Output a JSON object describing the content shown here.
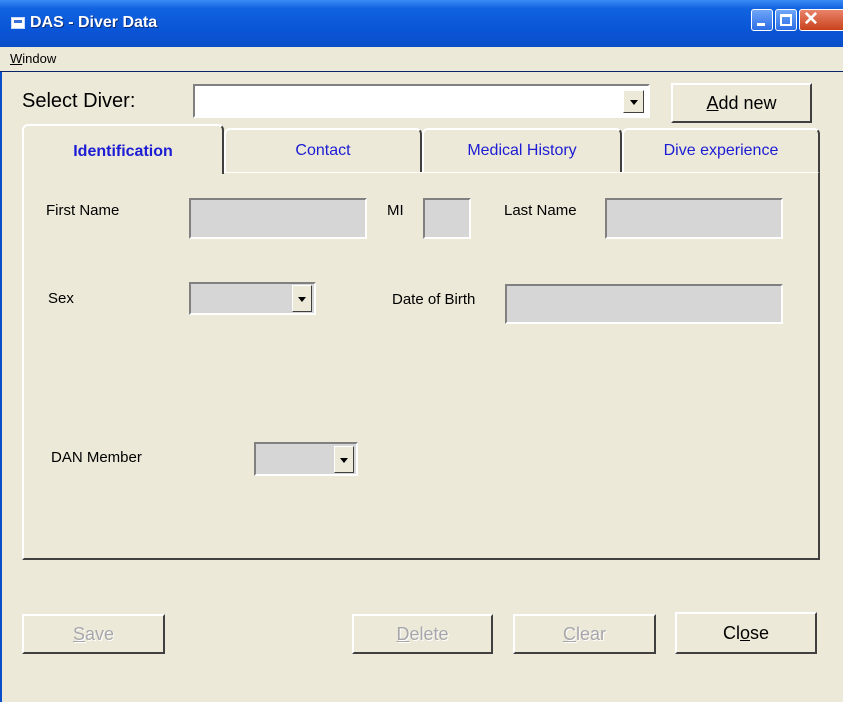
{
  "window": {
    "title": "DAS - Diver Data"
  },
  "menu": {
    "items": [
      {
        "label": "Window",
        "accel": "W",
        "rest": "indow"
      }
    ]
  },
  "select_diver": {
    "label": "Select Diver:",
    "value": "",
    "add_new": "Add new",
    "add_new_accel": "A",
    "add_new_rest": "dd new"
  },
  "tabs": [
    {
      "label": "Identification",
      "active": true
    },
    {
      "label": "Contact",
      "active": false
    },
    {
      "label": "Medical History",
      "active": false
    },
    {
      "label": "Dive experience",
      "active": false
    }
  ],
  "form": {
    "first_name_label": "First Name",
    "first_name": "",
    "mi_label": "MI",
    "mi": "",
    "last_name_label": "Last Name",
    "last_name": "",
    "sex_label": "Sex",
    "sex": "",
    "dob_label": "Date of Birth",
    "dob": "",
    "dan_member_label": "DAN Member",
    "dan_member": ""
  },
  "buttons": {
    "save": {
      "accel": "S",
      "rest": "ave",
      "enabled": false
    },
    "delete": {
      "accel": "D",
      "rest": "elete",
      "enabled": false
    },
    "clear": {
      "accel": "C",
      "rest": "lear",
      "enabled": false
    },
    "close": {
      "pre": "Cl",
      "accel": "o",
      "rest": "se",
      "enabled": true
    }
  },
  "colors": {
    "titlebar": "#0a56d8",
    "face": "#ece9d8",
    "tab_text": "#1c1cd4",
    "field_bg": "#d6d6d6"
  },
  "icons": [
    "app-icon",
    "minimize-icon",
    "maximize-icon",
    "close-icon",
    "dropdown-arrow-icon"
  ]
}
